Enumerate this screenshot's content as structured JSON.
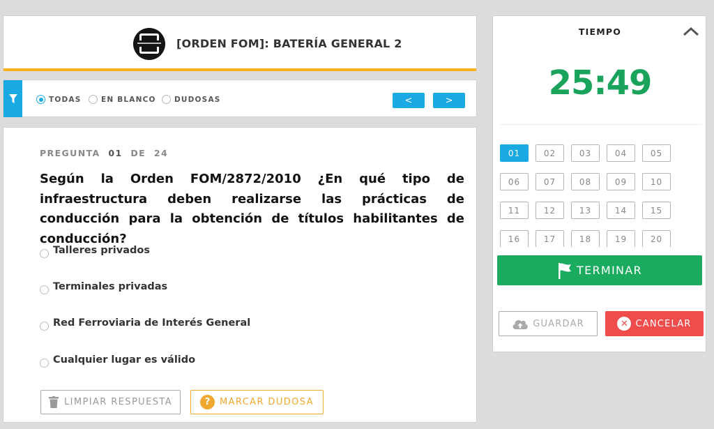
{
  "header": {
    "logo_icon": "academy-logo-icon",
    "title": "[ORDEN FOM]: BATERÍA GENERAL 2",
    "accent_color": "#f5b21d"
  },
  "filters": {
    "icon": "funnel-icon",
    "options": [
      {
        "label": "TODAS",
        "selected": true
      },
      {
        "label": "EN BLANCO",
        "selected": false
      },
      {
        "label": "DUDOSAS",
        "selected": false
      }
    ],
    "prev_label": "<",
    "next_label": ">",
    "accent_color": "#1aa9e3"
  },
  "question": {
    "counter_word": "PREGUNTA",
    "current": "01",
    "of_word": "DE",
    "total": "24",
    "text": "Según la Orden FOM/2872/2010 ¿En qué tipo de infraestructura deben realizarse las prácticas de conducción para la obtención de títulos habilitantes de conducción?",
    "answers": [
      "Talleres privados",
      "Terminales privadas",
      "Red Ferroviaria de Interés General",
      "Cualquier lugar es válido"
    ],
    "clear_label": "LIMPIAR RESPUESTA",
    "doubt_label": "MARCAR DUDOSA",
    "doubt_icon": "question-icon",
    "clear_icon": "trash-icon"
  },
  "timer": {
    "label": "TIEMPO",
    "value": "25:49",
    "collapse_icon": "chevron-up-icon",
    "color": "#1aa35b"
  },
  "grid": {
    "numbers": [
      "01",
      "02",
      "03",
      "04",
      "05",
      "06",
      "07",
      "08",
      "09",
      "10",
      "11",
      "12",
      "13",
      "14",
      "15",
      "16",
      "17",
      "18",
      "19",
      "20"
    ],
    "active": "01"
  },
  "actions": {
    "finish_label": "TERMINAR",
    "finish_icon": "flag-icon",
    "save_label": "GUARDAR",
    "save_icon": "cloud-upload-icon",
    "cancel_label": "CANCELAR",
    "cancel_icon": "close-circle-icon",
    "finish_color": "#1bab5f",
    "cancel_color": "#ef4c4c"
  }
}
